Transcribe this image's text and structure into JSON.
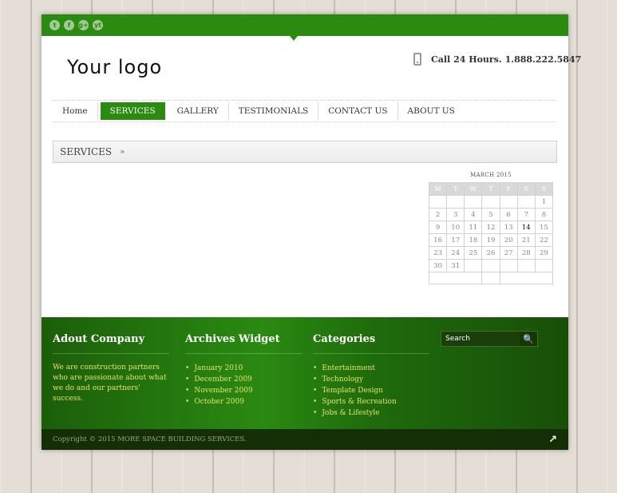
{
  "social": [
    "t",
    "f",
    "g+",
    "yt"
  ],
  "social_icons": [
    "twitter-icon",
    "facebook-icon",
    "google-plus-icon",
    "youtube-icon"
  ],
  "logo": "Your logo",
  "phone": "Call 24 Hours. 1.888.222.5847",
  "nav": [
    {
      "label": "Home"
    },
    {
      "label": "SERVICES"
    },
    {
      "label": "GALLERY"
    },
    {
      "label": "TESTIMONIALS"
    },
    {
      "label": "CONTACT US"
    },
    {
      "label": "ABOUT US"
    }
  ],
  "breadcrumb": {
    "label": "SERVICES",
    "sep": "»"
  },
  "calendar": {
    "caption": "MARCH 2015",
    "weekdays": [
      "M",
      "T",
      "W",
      "T",
      "F",
      "S",
      "S"
    ],
    "weeks": [
      [
        "",
        "",
        "",
        "",
        "",
        "",
        "1"
      ],
      [
        "2",
        "3",
        "4",
        "5",
        "6",
        "7",
        "8"
      ],
      [
        "9",
        "10",
        "11",
        "12",
        "13",
        "14",
        "15"
      ],
      [
        "16",
        "17",
        "18",
        "19",
        "20",
        "21",
        "22"
      ],
      [
        "23",
        "24",
        "25",
        "26",
        "27",
        "28",
        "29"
      ],
      [
        "30",
        "31",
        "",
        "",
        "",
        "",
        ""
      ]
    ],
    "today": "14"
  },
  "footer": {
    "about": {
      "title": "Adout Company",
      "text": "We are construction partners who are passionate about what we do and our partners' success."
    },
    "archives": {
      "title": "Archives Widget",
      "items": [
        "January 2010",
        "December 2009",
        "November 2009",
        "October 2009"
      ]
    },
    "categories": {
      "title": "Categories",
      "items": [
        "Entertainment",
        "Technology",
        "Template Design",
        "Sports & Recreation",
        "Jobs & Lifestyle"
      ]
    },
    "search": {
      "value": "Search",
      "button": "🔍"
    },
    "copyright": "Copyright © 2015 MORE SPACE BUILDING SERVICES.",
    "to_top": "↗"
  },
  "colors": {
    "accent": "#2b8a10",
    "footer_dark": "#142e06",
    "footer_text": "#e6e26a"
  }
}
